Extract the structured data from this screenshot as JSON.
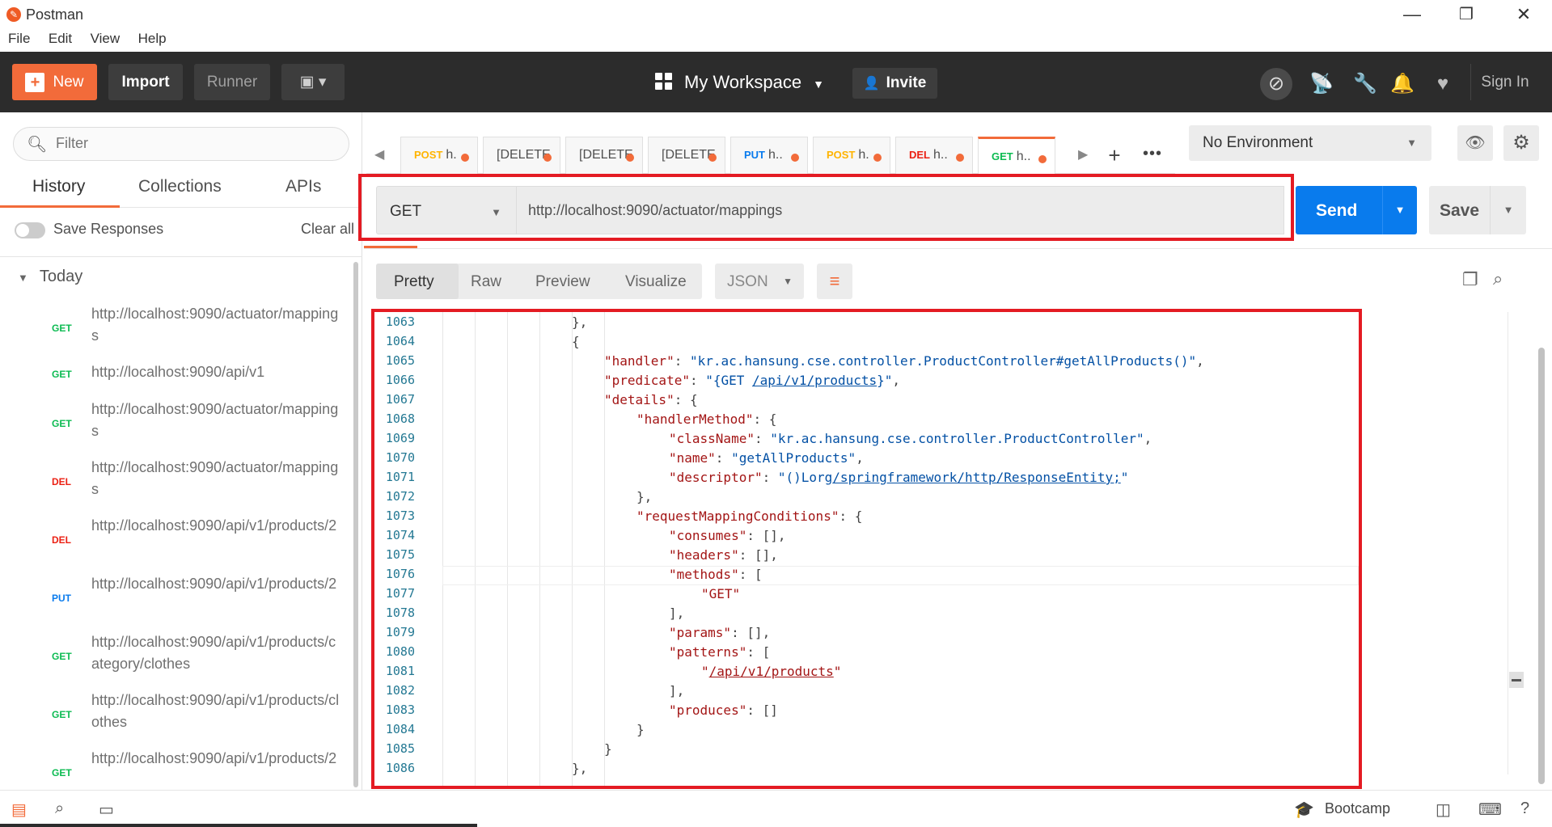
{
  "window": {
    "title": "Postman",
    "minimize": "—",
    "restore": "❐",
    "close": "✕"
  },
  "menu": [
    "File",
    "Edit",
    "View",
    "Help"
  ],
  "header": {
    "new_label": "New",
    "import_label": "Import",
    "runner_label": "Runner",
    "workspace_label": "My Workspace",
    "invite_label": "Invite",
    "signin_label": "Sign In"
  },
  "sidebar": {
    "filter_placeholder": "Filter",
    "tabs": [
      "History",
      "Collections",
      "APIs"
    ],
    "save_responses_label": "Save Responses",
    "clear_all_label": "Clear all",
    "group_label": "Today",
    "history": [
      {
        "method": "GET",
        "url": "http://localhost:9090/actuator/mappings",
        "color": "#0cbb52"
      },
      {
        "method": "GET",
        "url": "http://localhost:9090/api/v1",
        "color": "#0cbb52"
      },
      {
        "method": "GET",
        "url": "http://localhost:9090/actuator/mappings",
        "color": "#0cbb52"
      },
      {
        "method": "DEL",
        "url": "http://localhost:9090/actuator/mappings",
        "color": "#eb2013"
      },
      {
        "method": "DEL",
        "url": "http://localhost:9090/api/v1/products/2",
        "color": "#eb2013"
      },
      {
        "method": "PUT",
        "url": "http://localhost:9090/api/v1/products/2",
        "color": "#097bed"
      },
      {
        "method": "GET",
        "url": "http://localhost:9090/api/v1/products/category/clothes",
        "color": "#0cbb52"
      },
      {
        "method": "GET",
        "url": "http://localhost:9090/api/v1/products/clothes",
        "color": "#0cbb52"
      },
      {
        "method": "GET",
        "url": "http://localhost:9090/api/v1/products/2",
        "color": "#0cbb52"
      }
    ]
  },
  "request_tabs": [
    {
      "method": "POST",
      "label": "h.",
      "color": "#ffb400"
    },
    {
      "method": "",
      "label": "[DELETE",
      "color": "#666666"
    },
    {
      "method": "",
      "label": "[DELETE",
      "color": "#666666"
    },
    {
      "method": "",
      "label": "[DELETE",
      "color": "#666666"
    },
    {
      "method": "PUT",
      "label": "h..",
      "color": "#097bed"
    },
    {
      "method": "POST",
      "label": "h.",
      "color": "#ffb400"
    },
    {
      "method": "DEL",
      "label": "h..",
      "color": "#eb2013"
    },
    {
      "method": "GET",
      "label": "h..",
      "color": "#0cbb52"
    }
  ],
  "environment": {
    "selected": "No Environment"
  },
  "request": {
    "method": "GET",
    "url": "http://localhost:9090/actuator/mappings",
    "send_label": "Send",
    "save_label": "Save"
  },
  "response_toolbar": {
    "formats": [
      "Pretty",
      "Raw",
      "Preview",
      "Visualize"
    ],
    "language": "JSON"
  },
  "code": {
    "lines": [
      {
        "n": "1063",
        "indent": 6,
        "html": "},"
      },
      {
        "n": "1064",
        "indent": 6,
        "html": "{"
      },
      {
        "n": "1065",
        "indent": 7,
        "html": "<span class=\"k\">\"handler\"</span>: <span class=\"s\">\"kr.ac.hansung.cse.controller.ProductController#getAllProducts()\"</span>,"
      },
      {
        "n": "1066",
        "indent": 7,
        "html": "<span class=\"k\">\"predicate\"</span>: <span class=\"s\">\"{GET <span class=\"ul\">/api/v1/products</span>}\"</span>,"
      },
      {
        "n": "1067",
        "indent": 7,
        "html": "<span class=\"k\">\"details\"</span>: {"
      },
      {
        "n": "1068",
        "indent": 8,
        "html": "<span class=\"k\">\"handlerMethod\"</span>: {"
      },
      {
        "n": "1069",
        "indent": 9,
        "html": "<span class=\"k\">\"className\"</span>: <span class=\"s\">\"kr.ac.hansung.cse.controller.ProductController\"</span>,"
      },
      {
        "n": "1070",
        "indent": 9,
        "html": "<span class=\"k\">\"name\"</span>: <span class=\"s\">\"getAllProducts\"</span>,"
      },
      {
        "n": "1071",
        "indent": 9,
        "html": "<span class=\"k\">\"descriptor\"</span>: <span class=\"s\">\"()Lorg<span class=\"ul\">/springframework/http/ResponseEntity;</span>\"</span>"
      },
      {
        "n": "1072",
        "indent": 8,
        "html": "},"
      },
      {
        "n": "1073",
        "indent": 8,
        "html": "<span class=\"k\">\"requestMappingConditions\"</span>: {"
      },
      {
        "n": "1074",
        "indent": 9,
        "html": "<span class=\"k\">\"consumes\"</span>: [],"
      },
      {
        "n": "1075",
        "indent": 9,
        "html": "<span class=\"k\">\"headers\"</span>: [],"
      },
      {
        "n": "1076",
        "indent": 9,
        "html": "<span class=\"k\">\"methods\"</span>: ["
      },
      {
        "n": "1077",
        "indent": 10,
        "html": "<span class=\"k\">\"GET\"</span>"
      },
      {
        "n": "1078",
        "indent": 9,
        "html": "],"
      },
      {
        "n": "1079",
        "indent": 9,
        "html": "<span class=\"k\">\"params\"</span>: [],"
      },
      {
        "n": "1080",
        "indent": 9,
        "html": "<span class=\"k\">\"patterns\"</span>: ["
      },
      {
        "n": "1081",
        "indent": 10,
        "html": "<span class=\"k\">\"<span class=\"ul\">/api/v1/products</span>\"</span>"
      },
      {
        "n": "1082",
        "indent": 9,
        "html": "],"
      },
      {
        "n": "1083",
        "indent": 9,
        "html": "<span class=\"k\">\"produces\"</span>: []"
      },
      {
        "n": "1084",
        "indent": 8,
        "html": "}"
      },
      {
        "n": "1085",
        "indent": 7,
        "html": "}"
      },
      {
        "n": "1086",
        "indent": 6,
        "html": "},"
      }
    ]
  },
  "status": {
    "bootcamp_label": "Bootcamp"
  }
}
